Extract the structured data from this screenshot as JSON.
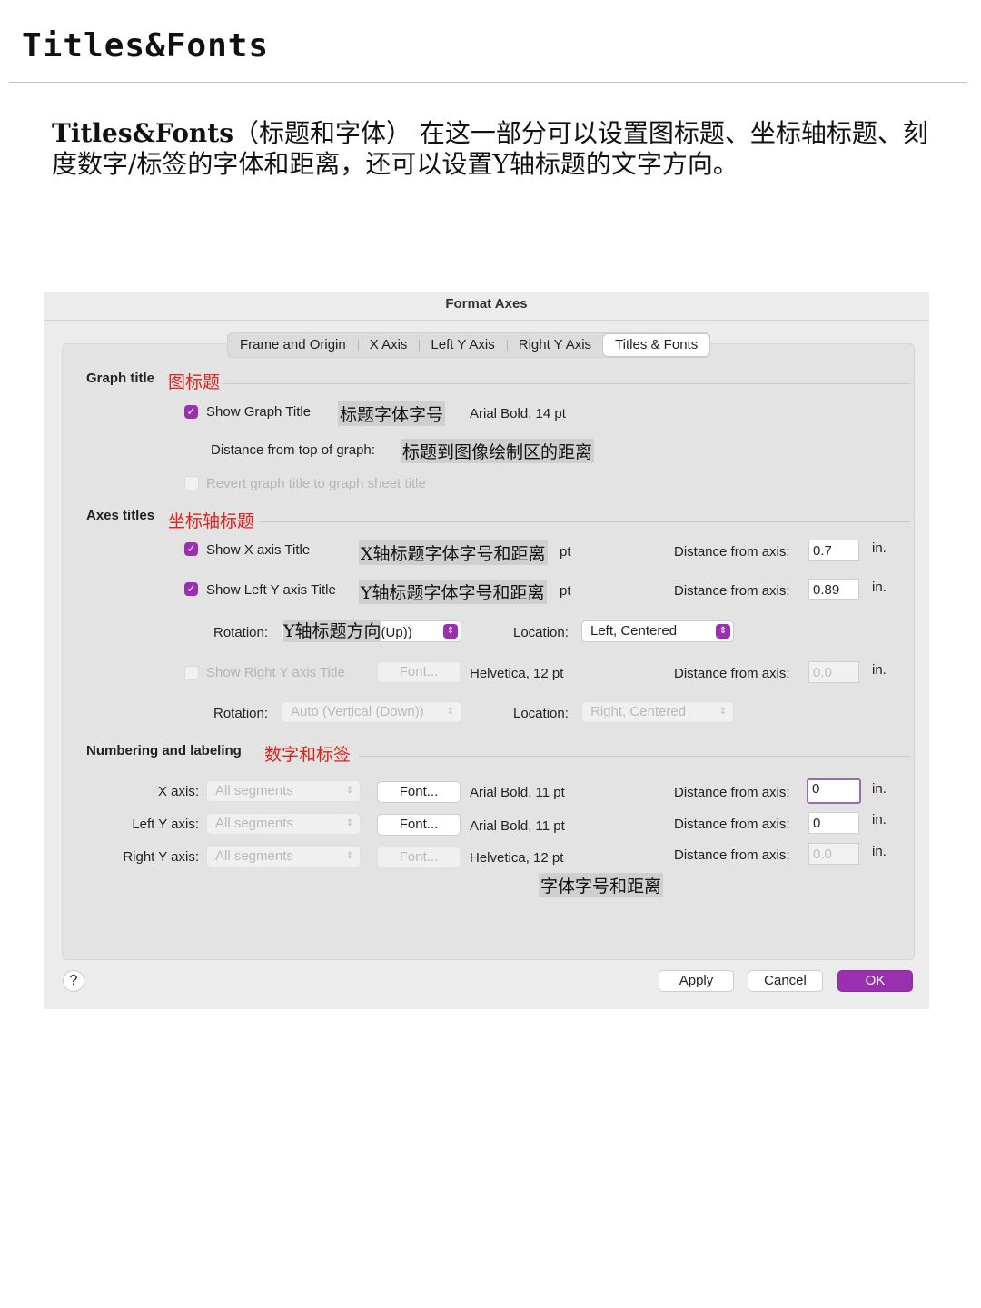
{
  "page": {
    "title": "Titles&Fonts",
    "intro_bold": "Titles&Fonts",
    "intro_text": "（标题和字体） 在这一部分可以设置图标题、坐标轴标题、刻度数字/标签的字体和距离，还可以设置Y轴标题的文字方向。"
  },
  "dialog": {
    "title": "Format Axes",
    "tabs": [
      {
        "label": "Frame and Origin",
        "active": false
      },
      {
        "label": "X Axis",
        "active": false
      },
      {
        "label": "Left Y Axis",
        "active": false
      },
      {
        "label": "Right Y Axis",
        "active": false
      },
      {
        "label": "Titles & Fonts",
        "active": true
      }
    ],
    "graph_title": {
      "label": "Graph title",
      "annotation": "图标题",
      "show_label": "Show Graph Title",
      "show_checked": true,
      "font_annotation": "标题字体字号",
      "font_value": "Arial Bold, 14 pt",
      "distance_label": "Distance from top of graph:",
      "distance_annotation": "标题到图像绘制区的距离",
      "revert_label": "Revert graph title to graph sheet title",
      "revert_checked": false
    },
    "axes_titles": {
      "label": "Axes titles",
      "annotation": "坐标轴标题",
      "x": {
        "show_label": "Show X axis Title",
        "checked": true,
        "annotation": "X轴标题字体字号和距离",
        "pt_suffix": "pt",
        "distance_label": "Distance from axis:",
        "distance_value": "0.7",
        "unit": "in."
      },
      "left_y": {
        "show_label": "Show Left Y axis Title",
        "checked": true,
        "annotation": "Y轴标题字体字号和距离",
        "pt_suffix": "pt",
        "distance_label": "Distance from axis:",
        "distance_value": "0.89",
        "unit": "in.",
        "rotation_label": "Rotation:",
        "rotation_annotation": "Y轴标题方向",
        "rotation_value_tail": "(Up))",
        "location_label": "Location:",
        "location_value": "Left, Centered"
      },
      "right_y": {
        "show_label": "Show Right Y axis Title",
        "checked": false,
        "font_button": "Font...",
        "font_value": "Helvetica, 12 pt",
        "distance_label": "Distance from axis:",
        "distance_value": "0.0",
        "unit": "in.",
        "rotation_label": "Rotation:",
        "rotation_value": "Auto (Vertical (Down))",
        "location_label": "Location:",
        "location_value": "Right, Centered"
      }
    },
    "numbering": {
      "label": "Numbering and labeling",
      "annotation": "数字和标签",
      "rows": [
        {
          "axis_label": "X axis:",
          "segments": "All segments",
          "font_button": "Font...",
          "font_value": "Arial Bold, 11 pt",
          "distance_label": "Distance from axis:",
          "distance_value": "0",
          "unit": "in."
        },
        {
          "axis_label": "Left Y axis:",
          "segments": "All segments",
          "font_button": "Font...",
          "font_value": "Arial Bold, 11 pt",
          "distance_label": "Distance from axis:",
          "distance_value": "0",
          "unit": "in."
        },
        {
          "axis_label": "Right Y axis:",
          "segments": "All segments",
          "font_button": "Font...",
          "font_value": "Helvetica, 12 pt",
          "distance_label": "Distance from axis:",
          "distance_value": "0.0",
          "unit": "in."
        }
      ],
      "footer_annotation": "字体字号和距离"
    },
    "buttons": {
      "help": "?",
      "apply": "Apply",
      "cancel": "Cancel",
      "ok": "OK"
    },
    "colors": {
      "accent": "#9a2fb0",
      "annotation_red": "#e0201a"
    }
  }
}
